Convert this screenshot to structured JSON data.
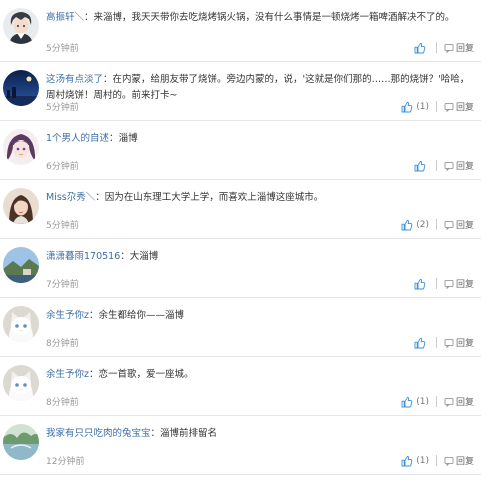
{
  "comments": [
    {
      "author": "高振轩＼",
      "text": "来淄博，我天天带你去吃烧烤锅火锅，没有什么事情是一顿烧烤一箱啤酒解决不了的。",
      "time": "5分钟前",
      "likes": "",
      "reply": "回复",
      "avatar": "anime-boy"
    },
    {
      "author": "这汤有点淡了",
      "text": "在内蒙，给朋友带了烧饼。旁边内蒙的，说，'这就是你们那的……那的烧饼？'哈哈，周村烧饼！周村的。前来打卡~",
      "time": "5分钟前",
      "likes": "(1)",
      "reply": "回复",
      "avatar": "night-scene"
    },
    {
      "author": "1个男人的自述",
      "text": "淄博",
      "time": "6分钟前",
      "likes": "",
      "reply": "回复",
      "avatar": "anime-girl"
    },
    {
      "author": "Miss尕秀＼",
      "text": "因为在山东理工大学上学，而喜欢上淄博这座城市。",
      "time": "5分钟前",
      "likes": "(2)",
      "reply": "回复",
      "avatar": "woman"
    },
    {
      "author": "潇潇暮雨170516",
      "text": "大淄博",
      "time": "7分钟前",
      "likes": "",
      "reply": "回复",
      "avatar": "landscape"
    },
    {
      "author": "余生予你z",
      "text": "余生都给你——淄博",
      "time": "8分钟前",
      "likes": "",
      "reply": "回复",
      "avatar": "white-cat"
    },
    {
      "author": "余生予你z",
      "text": "恋一首歌，爱一座城。",
      "time": "8分钟前",
      "likes": "(1)",
      "reply": "回复",
      "avatar": "white-cat"
    },
    {
      "author": "我家有只只吃肉的兔宝宝",
      "text": "淄博前排留名",
      "time": "12分钟前",
      "likes": "(1)",
      "reply": "回复",
      "avatar": "lake-scene"
    }
  ],
  "colors": {
    "author": "#3a6ea5",
    "like_icon": "#3a8fd8",
    "time": "#999999"
  }
}
